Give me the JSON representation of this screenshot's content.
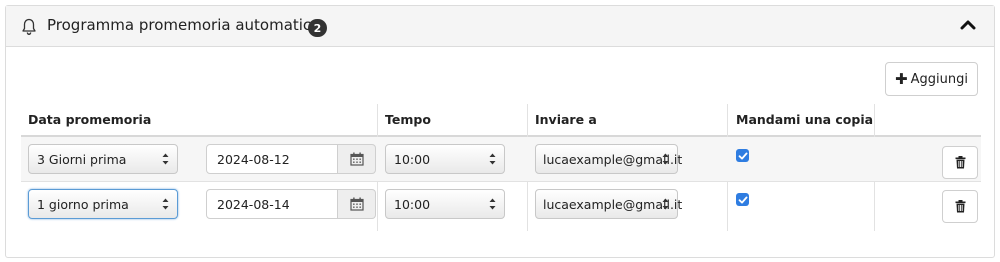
{
  "header": {
    "title": "Programma promemoria automatico",
    "count": "2",
    "icon": "bell-icon",
    "collapse_icon": "chevron-up-icon"
  },
  "toolbar": {
    "add_label": "Aggiungi"
  },
  "table": {
    "columns": [
      "Data promemoria",
      "Tempo",
      "Inviare a",
      "Mandami una copia"
    ],
    "rows": [
      {
        "when": "3 Giorni prima",
        "date": "2024-08-12",
        "time": "10:00",
        "recipient": "lucaexample@gmail.it",
        "copy": true
      },
      {
        "when": "1 giorno prima",
        "date": "2024-08-14",
        "time": "10:00",
        "recipient": "lucaexample@gmail.it",
        "copy": true
      }
    ]
  },
  "colors": {
    "badge": "#333333",
    "checkbox": "#2f7de1",
    "focus": "#5b9bd5"
  }
}
